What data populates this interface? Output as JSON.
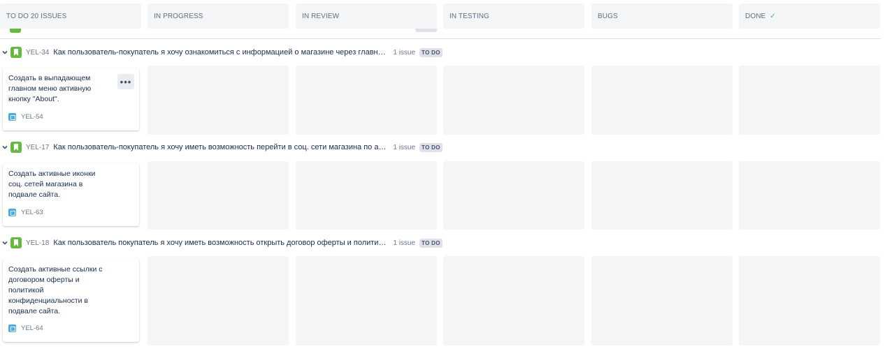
{
  "columns": [
    {
      "label": "TO DO 20 ISSUES"
    },
    {
      "label": "IN PROGRESS"
    },
    {
      "label": "IN REVIEW"
    },
    {
      "label": "IN TESTING"
    },
    {
      "label": "BUGS"
    },
    {
      "label": "DONE",
      "check_icon": "checkmark-icon"
    }
  ],
  "swimlanes": [
    {
      "key": "YEL-34",
      "summary": "Как пользователь-покупатель я хочу ознакомиться с информацией о магазине через главное ме...",
      "count": "1 issue",
      "status": "TO DO",
      "card": {
        "text": "Создать в выпадающем главном меню активную кнопку \"About\".",
        "key": "YEL-54",
        "more": "•••"
      }
    },
    {
      "key": "YEL-17",
      "summary": "Как пользователь-покупатель я хочу иметь возможность перейти в соц. сети магазина по активн...",
      "count": "1 issue",
      "status": "TO DO",
      "card": {
        "text": "Создать активные иконки соц. сетей магазина в подвале сайта.",
        "key": "YEL-63"
      }
    },
    {
      "key": "YEL-18",
      "summary": "Как пользователь покупатель я хочу иметь возможность открыть договор оферты и политику ко...",
      "count": "1 issue",
      "status": "TO DO",
      "card": {
        "text": "Создать активные ссылки с договором оферты и политикой конфиденциальности в подвале сайта.",
        "key": "YEL-64"
      }
    }
  ],
  "colors": {
    "story": "#63ba3c",
    "task": "#4bade8",
    "done_check": "#36b37e",
    "column_bg": "#f4f5f7"
  },
  "icons": [
    "chevron-down-icon",
    "story-icon",
    "task-icon",
    "more-icon",
    "checkmark-icon"
  ]
}
